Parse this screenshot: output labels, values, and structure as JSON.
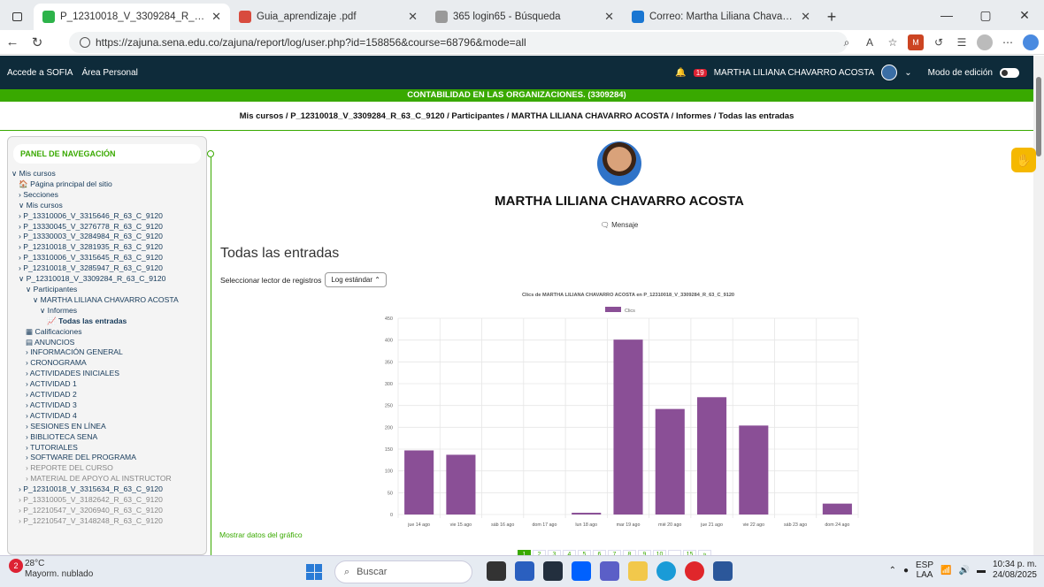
{
  "browser": {
    "tabs": [
      {
        "title": "P_12310018_V_3309284_R_63_C_9",
        "color": "#2db34a",
        "active": true
      },
      {
        "title": "Guia_aprendizaje .pdf",
        "color": "#d84b3e",
        "active": false
      },
      {
        "title": "365 login65 - Búsqueda",
        "color": "#999999",
        "active": false
      },
      {
        "title": "Correo: Martha Liliana Chavarro A",
        "color": "#1976d2",
        "active": false
      }
    ],
    "url": "https://zajuna.sena.edu.co/zajuna/report/log/user.php?id=158856&course=68796&mode=all"
  },
  "topnav": {
    "links": [
      "Accede a SOFIA",
      "Área Personal"
    ],
    "notif_count": "19",
    "user_name": "MARTHA LILIANA CHAVARRO ACOSTA",
    "edit_mode": "Modo de edición"
  },
  "course_banner": "CONTABILIDAD EN LAS ORGANIZACIONES. (3309284)",
  "breadcrumb": "Mis cursos / P_12310018_V_3309284_R_63_C_9120 / Participantes / MARTHA LILIANA CHAVARRO ACOSTA / Informes / Todas las entradas",
  "sidebar": {
    "title": "PANEL DE NAVEGACIÓN",
    "items": [
      {
        "label": "∨ Mis cursos",
        "indent": 0,
        "style": ""
      },
      {
        "label": "🏠 Página principal del sitio",
        "indent": 1,
        "style": ""
      },
      {
        "label": "› Secciones",
        "indent": 1,
        "style": ""
      },
      {
        "label": "∨ Mis cursos",
        "indent": 1,
        "style": ""
      },
      {
        "label": "› P_13310006_V_3315646_R_63_C_9120",
        "indent": 1,
        "style": ""
      },
      {
        "label": "› P_13330045_V_3276778_R_63_C_9120",
        "indent": 1,
        "style": ""
      },
      {
        "label": "› P_13330003_V_3284984_R_63_C_9120",
        "indent": 1,
        "style": ""
      },
      {
        "label": "› P_12310018_V_3281935_R_63_C_9120",
        "indent": 1,
        "style": ""
      },
      {
        "label": "› P_13310006_V_3315645_R_63_C_9120",
        "indent": 1,
        "style": ""
      },
      {
        "label": "› P_12310018_V_3285947_R_63_C_9120",
        "indent": 1,
        "style": ""
      },
      {
        "label": "∨ P_12310018_V_3309284_R_63_C_9120",
        "indent": 1,
        "style": ""
      },
      {
        "label": "∨ Participantes",
        "indent": 2,
        "style": ""
      },
      {
        "label": "∨ MARTHA LILIANA CHAVARRO ACOSTA",
        "indent": 3,
        "style": ""
      },
      {
        "label": "∨ Informes",
        "indent": 4,
        "style": ""
      },
      {
        "label": "📈 Todas las entradas",
        "indent": 5,
        "style": "bold"
      },
      {
        "label": "▦ Calificaciones",
        "indent": 2,
        "style": ""
      },
      {
        "label": "▤ ANUNCIOS",
        "indent": 2,
        "style": ""
      },
      {
        "label": "› INFORMACIÓN GENERAL",
        "indent": 2,
        "style": ""
      },
      {
        "label": "› CRONOGRAMA",
        "indent": 2,
        "style": ""
      },
      {
        "label": "› ACTIVIDADES INICIALES",
        "indent": 2,
        "style": ""
      },
      {
        "label": "› ACTIVIDAD 1",
        "indent": 2,
        "style": ""
      },
      {
        "label": "› ACTIVIDAD 2",
        "indent": 2,
        "style": ""
      },
      {
        "label": "› ACTIVIDAD 3",
        "indent": 2,
        "style": ""
      },
      {
        "label": "› ACTIVIDAD 4",
        "indent": 2,
        "style": ""
      },
      {
        "label": "› SESIONES EN LÍNEA",
        "indent": 2,
        "style": ""
      },
      {
        "label": "› BIBLIOTECA SENA",
        "indent": 2,
        "style": ""
      },
      {
        "label": "› TUTORIALES",
        "indent": 2,
        "style": ""
      },
      {
        "label": "› SOFTWARE DEL PROGRAMA",
        "indent": 2,
        "style": ""
      },
      {
        "label": "› REPORTE DEL CURSO",
        "indent": 2,
        "style": "gray"
      },
      {
        "label": "› MATERIAL DE APOYO AL INSTRUCTOR",
        "indent": 2,
        "style": "gray"
      },
      {
        "label": "› P_12310018_V_3315634_R_63_C_9120",
        "indent": 1,
        "style": ""
      },
      {
        "label": "› P_13310005_V_3182642_R_63_C_9120",
        "indent": 1,
        "style": "gray"
      },
      {
        "label": "› P_12210547_V_3206940_R_63_C_9120",
        "indent": 1,
        "style": "gray"
      },
      {
        "label": "› P_12210547_V_3148248_R_63_C_9120",
        "indent": 1,
        "style": "gray"
      }
    ]
  },
  "profile": {
    "name": "MARTHA LILIANA CHAVARRO ACOSTA",
    "message": "Mensaje"
  },
  "page": {
    "heading": "Todas las entradas",
    "reader_label": "Seleccionar lector de registros",
    "reader_value": "Log estándar",
    "show_data": "Mostrar datos del gráfico"
  },
  "chart_data": {
    "type": "bar",
    "title": "Clics de MARTHA LILIANA CHAVARRO ACOSTA  en P_12310018_V_3309284_R_63_C_9120",
    "legend": "Clics",
    "color": "#8a4f96",
    "categories": [
      "jue 14 ago",
      "vie 15 ago",
      "sáb 16 ago",
      "dom 17 ago",
      "lun 18 ago",
      "mar 19 ago",
      "mié 20 ago",
      "jue 21 ago",
      "vie 22 ago",
      "sáb 23 ago",
      "dom 24 ago"
    ],
    "values": [
      147,
      137,
      0,
      0,
      4,
      401,
      242,
      269,
      204,
      0,
      25
    ],
    "ylim": [
      0,
      450
    ],
    "yticks": [
      0,
      50,
      100,
      150,
      200,
      250,
      300,
      350,
      400,
      450
    ]
  },
  "pager": [
    "1",
    "2",
    "3",
    "4",
    "5",
    "6",
    "7",
    "8",
    "9",
    "10",
    "...",
    "15",
    "»"
  ],
  "taskbar": {
    "weather_temp": "28°C",
    "weather_desc": "Mayorm. nublado",
    "weather_badge": "2",
    "search": "Buscar",
    "lang": "ESP",
    "lang2": "LAA",
    "time": "10:34 p. m.",
    "date": "24/08/2025"
  }
}
